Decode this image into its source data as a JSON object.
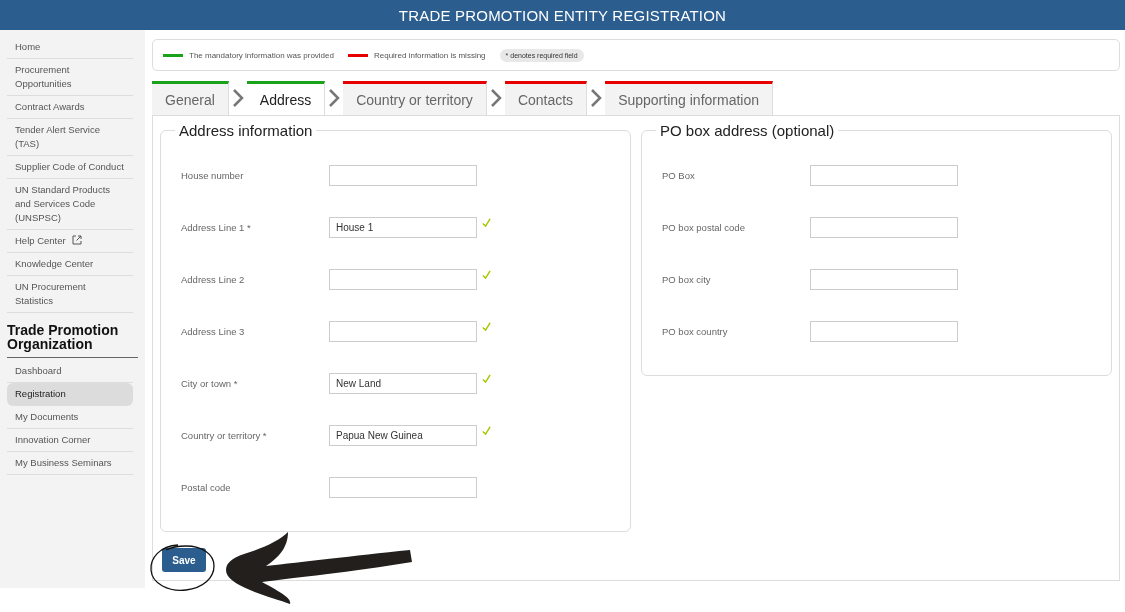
{
  "header": {
    "title": "TRADE PROMOTION ENTITY REGISTRATION"
  },
  "sidebar": {
    "items": [
      {
        "label": "Home",
        "external": false,
        "selected": false
      },
      {
        "label": "Procurement Opportunities",
        "external": false,
        "selected": false
      },
      {
        "label": "Contract Awards",
        "external": false,
        "selected": false
      },
      {
        "label": "Tender Alert Service (TAS)",
        "external": false,
        "selected": false
      },
      {
        "label": "Supplier Code of Conduct",
        "external": false,
        "selected": false
      },
      {
        "label": "UN Standard Products and Services Code (UNSPSC)",
        "external": false,
        "selected": false
      },
      {
        "label": "Help Center",
        "external": true,
        "selected": false
      },
      {
        "label": "Knowledge Center",
        "external": false,
        "selected": false
      },
      {
        "label": "UN Procurement Statistics",
        "external": false,
        "selected": false
      }
    ],
    "section_title": "Trade Promotion Organization",
    "section_items": [
      {
        "label": "Dashboard",
        "selected": false
      },
      {
        "label": "Registration",
        "selected": true
      },
      {
        "label": "My Documents",
        "selected": false
      },
      {
        "label": "Innovation Corner",
        "selected": false
      },
      {
        "label": "My Business Seminars",
        "selected": false
      }
    ]
  },
  "legend": {
    "items": [
      {
        "label": "The mandatory information was provided",
        "color": "#1aa31a"
      },
      {
        "label": "Required information is missing",
        "color": "#e60000"
      }
    ],
    "note": "* denotes required field"
  },
  "tabs": [
    {
      "label": "General",
      "selected": false,
      "color": "#1aa31a"
    },
    {
      "label": "Address",
      "selected": true,
      "color": "#1aa31a"
    },
    {
      "label": "Country or territory",
      "selected": false,
      "color": "#e60000"
    },
    {
      "label": "Contacts",
      "selected": false,
      "color": "#e60000"
    },
    {
      "label": "Supporting information",
      "selected": false,
      "color": "#e60000"
    }
  ],
  "panels": [
    {
      "title": "Address information",
      "fields": [
        {
          "label": "House number",
          "valid": false
        },
        {
          "label": "Address Line 1 *",
          "value": "House 1",
          "valid": true
        },
        {
          "label": "Address Line 2",
          "valid": true
        },
        {
          "label": "Address Line 3",
          "valid": true
        },
        {
          "label": "City or town *",
          "value": "New Land",
          "valid": true
        },
        {
          "label": "Country or territory *",
          "value": "Papua New Guinea",
          "valid": true
        },
        {
          "label": "Postal code",
          "valid": false
        }
      ]
    },
    {
      "title": "PO box address (optional)",
      "fields": [
        {
          "label": "PO Box",
          "valid": false
        },
        {
          "label": "PO box postal code",
          "valid": false
        },
        {
          "label": "PO box city",
          "valid": false
        },
        {
          "label": "PO box country",
          "valid": false
        }
      ]
    }
  ],
  "save_button": "Save"
}
